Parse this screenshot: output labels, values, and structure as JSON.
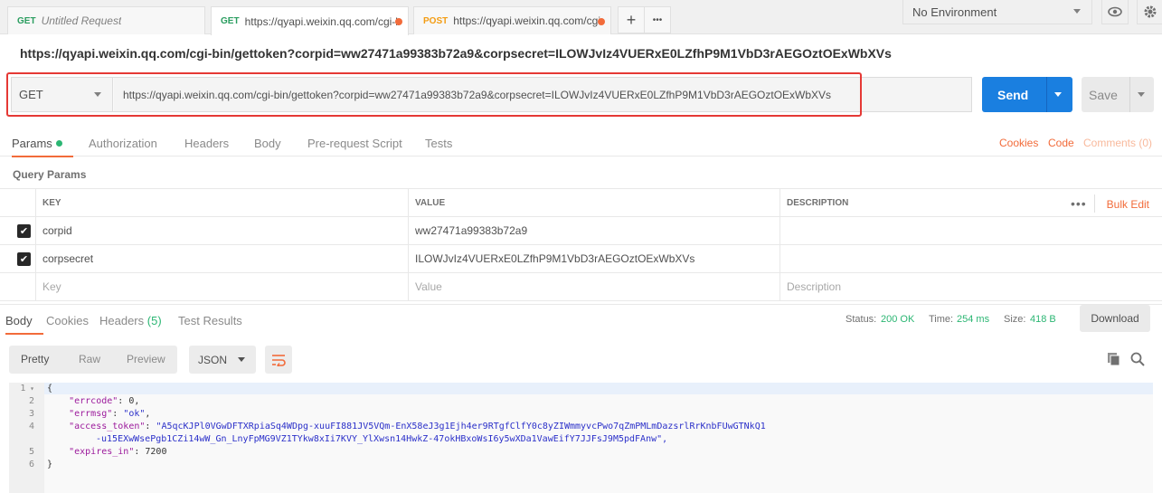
{
  "tabs": [
    {
      "method": "GET",
      "title": "Untitled Request",
      "italic": true
    },
    {
      "method": "GET",
      "title": "https://qyapi.weixin.qq.com/cgi-bin/gettoken",
      "active": true
    },
    {
      "method": "POST",
      "title": "https://qyapi.weixin.qq.com/cgi-bin/message"
    }
  ],
  "tab_actions": {
    "add": "+",
    "more": "•••"
  },
  "environment": {
    "selected": "No Environment"
  },
  "request": {
    "url_title": "https://qyapi.weixin.qq.com/cgi-bin/gettoken?corpid=ww27471a99383b72a9&corpsecret=ILOWJvIz4VUERxE0LZfhP9M1VbD3rAEGOztOExWbXVs",
    "method": "GET",
    "url": "https://qyapi.weixin.qq.com/cgi-bin/gettoken?corpid=ww27471a99383b72a9&corpsecret=ILOWJvIz4VUERxE0LZfhP9M1VbD3rAEGOztOExWbXVs",
    "send_label": "Send",
    "save_label": "Save"
  },
  "request_tabs": {
    "params": "Params",
    "authorization": "Authorization",
    "headers": "Headers",
    "body": "Body",
    "pre_request": "Pre-request Script",
    "tests": "Tests",
    "cookies": "Cookies",
    "code": "Code",
    "comments": "Comments (0)"
  },
  "query_params": {
    "title": "Query Params",
    "columns": {
      "key": "KEY",
      "value": "VALUE",
      "description": "DESCRIPTION"
    },
    "bulk_edit": "Bulk Edit",
    "more": "•••",
    "rows": [
      {
        "key": "corpid",
        "value": "ww27471a99383b72a9",
        "checked": true
      },
      {
        "key": "corpsecret",
        "value": "ILOWJvIz4VUERxE0LZfhP9M1VbD3rAEGOztOExWbXVs",
        "checked": true
      }
    ],
    "placeholders": {
      "key": "Key",
      "value": "Value",
      "description": "Description"
    }
  },
  "response": {
    "tabs": {
      "body": "Body",
      "cookies": "Cookies",
      "headers": "Headers",
      "headers_count": "(5)",
      "test_results": "Test Results"
    },
    "status_label": "Status:",
    "status_value": "200 OK",
    "time_label": "Time:",
    "time_value": "254 ms",
    "size_label": "Size:",
    "size_value": "418 B",
    "download_label": "Download",
    "view_modes": {
      "pretty": "Pretty",
      "raw": "Raw",
      "preview": "Preview"
    },
    "format": "JSON",
    "code_lines": [
      {
        "num": "1",
        "text": "{"
      },
      {
        "num": "2",
        "key": "\"errcode\"",
        "value": "0",
        "type": "number",
        "trail": ","
      },
      {
        "num": "3",
        "key": "\"errmsg\"",
        "value": "\"ok\"",
        "type": "string",
        "trail": ","
      },
      {
        "num": "4",
        "key": "\"access_token\"",
        "value": "\"A5qcKJPl0VGwDFTXRpiaSq4WDpg-xuuFI881JV5VQm-EnX58eJ3g1Ejh4er9RTgfClfY0c8yZIWmmyvcPwo7qZmPMLmDazsrlRrKnbFUwGTNkQ1",
        "type": "string"
      },
      {
        "num": "",
        "text": "-u15EXwWsePgb1CZi14wW_Gn_LnyFpMG9VZ1TYkw8xIi7KVY_YlXwsn14HwkZ-47okHBxoWsI6y5wXDa1VawEifY7JJFsJ9M5pdFAnw\",",
        "type": "string-cont"
      },
      {
        "num": "5",
        "key": "\"expires_in\"",
        "value": "7200",
        "type": "number"
      },
      {
        "num": "6",
        "text": "}"
      }
    ]
  },
  "colors": {
    "accent": "#f26b3a",
    "send": "#1a7fe0",
    "success": "#2bb673",
    "highlight": "#e53935"
  }
}
